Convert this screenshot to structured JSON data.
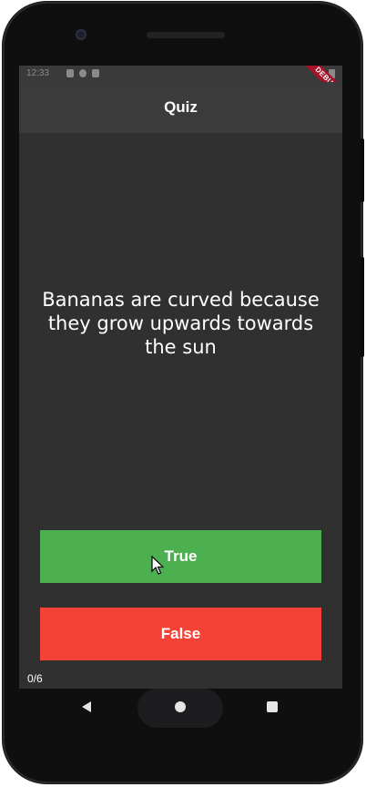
{
  "status_bar": {
    "time": "12:33"
  },
  "debug_banner": "DEBUG",
  "app_bar": {
    "title": "Quiz"
  },
  "quiz": {
    "question": "Bananas are curved because they grow upwards towards the sun",
    "true_label": "True",
    "false_label": "False",
    "score": "0/6"
  },
  "colors": {
    "true_button": "#4caf50",
    "false_button": "#f44336",
    "background": "#303030",
    "app_bar": "#3b3b3b"
  },
  "icons": {
    "back": "back-triangle-icon",
    "home": "home-circle-icon",
    "recents": "recents-square-icon"
  }
}
